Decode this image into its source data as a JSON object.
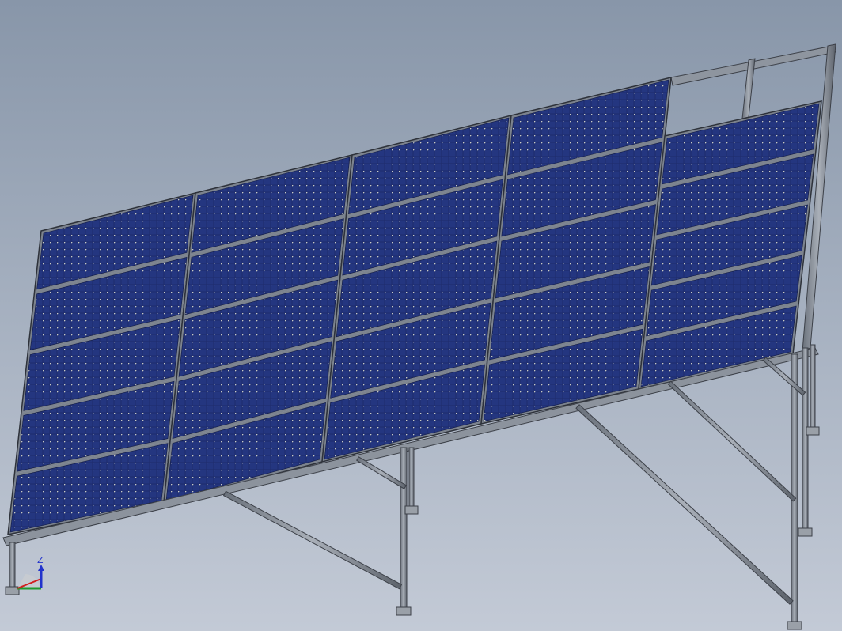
{
  "window": {
    "title": "",
    "background_top": "#8896a9",
    "background_bottom": "#c3cad6"
  },
  "model": {
    "description_visible": false,
    "panel_rows": 5,
    "panel_columns": 5,
    "panel_color": "#1c2a66",
    "frame_color": "#7c838e",
    "steel_color": "#8c939d"
  },
  "triad": {
    "z_label": "Z",
    "x_color": "#d21f1f",
    "y_color": "#1f9a2f",
    "z_color": "#2233cc"
  }
}
